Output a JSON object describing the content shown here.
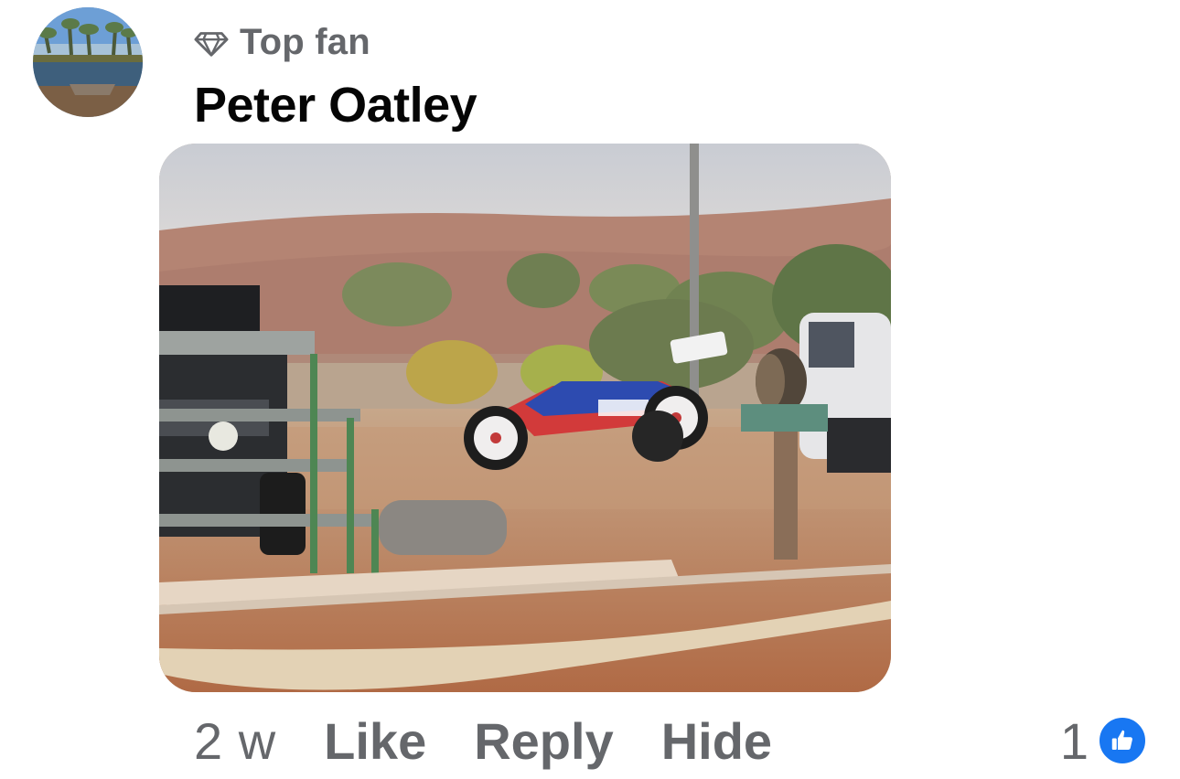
{
  "comment": {
    "badge_icon": "diamond-icon",
    "badge_label": "Top fan",
    "author": "Peter Oatley",
    "photo_icon": "comment-photo",
    "time": "2 w",
    "actions": {
      "like": "Like",
      "reply": "Reply",
      "hide": "Hide"
    },
    "reaction_count": "1",
    "reaction_icon": "thumbs-up-icon"
  },
  "colors": {
    "secondary_text": "#65676b",
    "primary_text": "#050505",
    "like_blue": "#1877f2"
  }
}
